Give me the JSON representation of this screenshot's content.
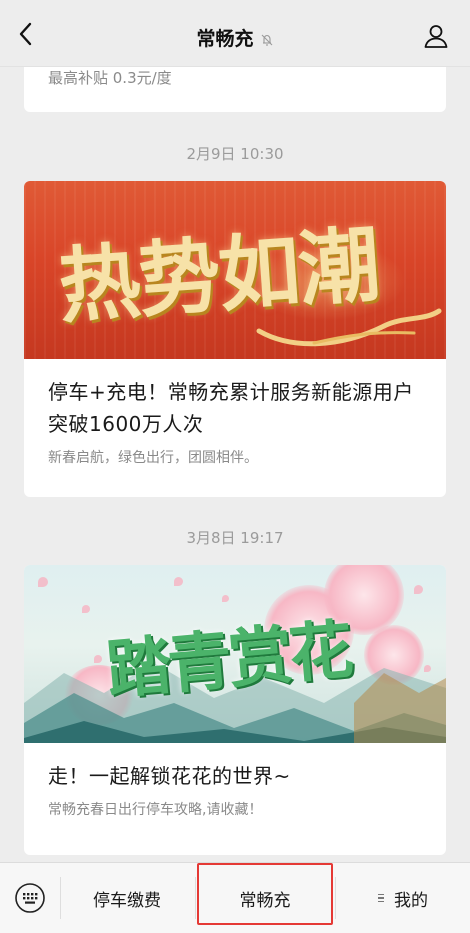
{
  "header": {
    "back_icon": "chevron-left-icon",
    "title": "常畅充",
    "mute_icon": "bell-muted-icon",
    "profile_icon": "person-icon"
  },
  "messages": [
    {
      "subtitle": "最高补贴 0.3元/度"
    },
    {
      "timestamp": "2月9日 10:30",
      "banner_text": "热势如潮",
      "title": "停车+充电！常畅充累计服务新能源用户突破1600万人次",
      "desc": "新春启航，绿色出行，团圆相伴。"
    },
    {
      "timestamp": "3月8日 19:17",
      "banner_text": "踏青赏花",
      "title": "走！一起解锁花花的世界~",
      "desc": "常畅充春日出行停车攻略,请收藏！"
    }
  ],
  "bottom_menu": {
    "keyboard_icon": "keyboard-icon",
    "items": [
      {
        "label": "停车缴费"
      },
      {
        "label": "常畅充"
      },
      {
        "label": "我的"
      }
    ]
  },
  "colors": {
    "highlight": "#e53935",
    "background": "#ededed"
  }
}
